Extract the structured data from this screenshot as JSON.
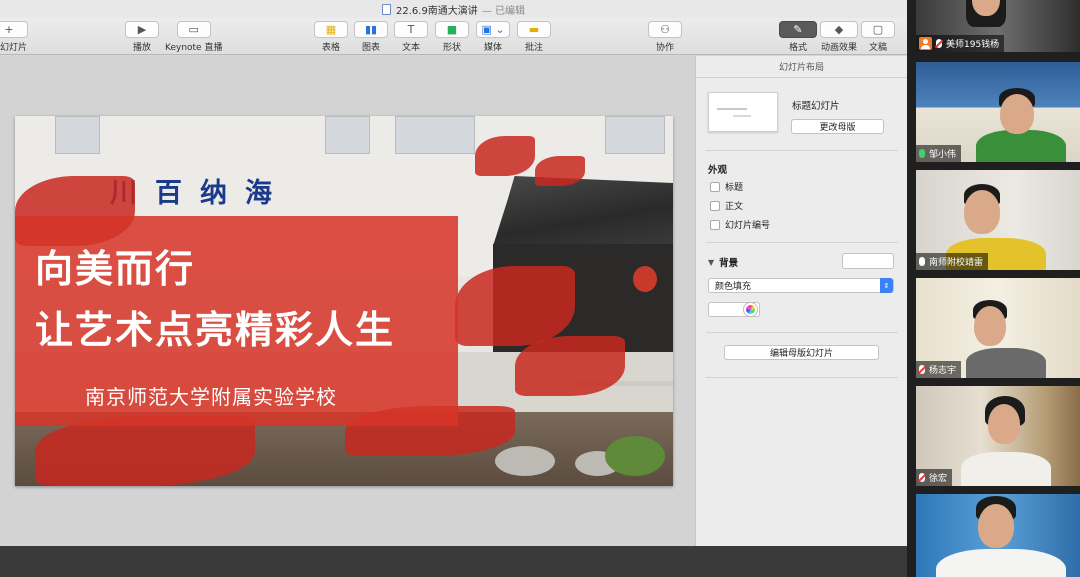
{
  "window": {
    "title": "22.6.9南通大演讲",
    "status": "— 已编辑"
  },
  "toolbar": {
    "add_slide": "加幻灯片",
    "play": "播放",
    "keynote_live": "Keynote 直播",
    "table": "表格",
    "chart": "图表",
    "text": "文本",
    "shape": "形状",
    "media": "媒体",
    "comment": "批注",
    "collaborate": "协作",
    "format": "格式",
    "animate": "动画效果",
    "document": "文稿"
  },
  "slide": {
    "sign": "川百纳海",
    "title_line1": "向美而行",
    "title_line2": "让艺术点亮精彩人生",
    "subtitle": "南京师范大学附属实验学校"
  },
  "inspector": {
    "header": "幻灯片布局",
    "layout_name": "标题幻灯片",
    "change_master": "更改母版",
    "appearance_label": "外观",
    "options": [
      "标题",
      "正文",
      "幻灯片编号"
    ],
    "background_label": "背景",
    "fill_type": "颜色填充",
    "edit_master": "编辑母版幻灯片"
  },
  "participants": [
    {
      "name": "美师195钱杨",
      "status": "muted"
    },
    {
      "name": "邹小伟",
      "status": "active"
    },
    {
      "name": "南师附校靖雷",
      "status": "on"
    },
    {
      "name": "杨志宇",
      "status": "muted"
    },
    {
      "name": "徐宏",
      "status": "muted"
    },
    {
      "name": "",
      "status": "none"
    }
  ],
  "colors": {
    "panel_red": "#d63428",
    "sign_blue": "#1c3a8a",
    "accent_blue": "#3b82f6",
    "mic_active": "#3fd16b"
  }
}
